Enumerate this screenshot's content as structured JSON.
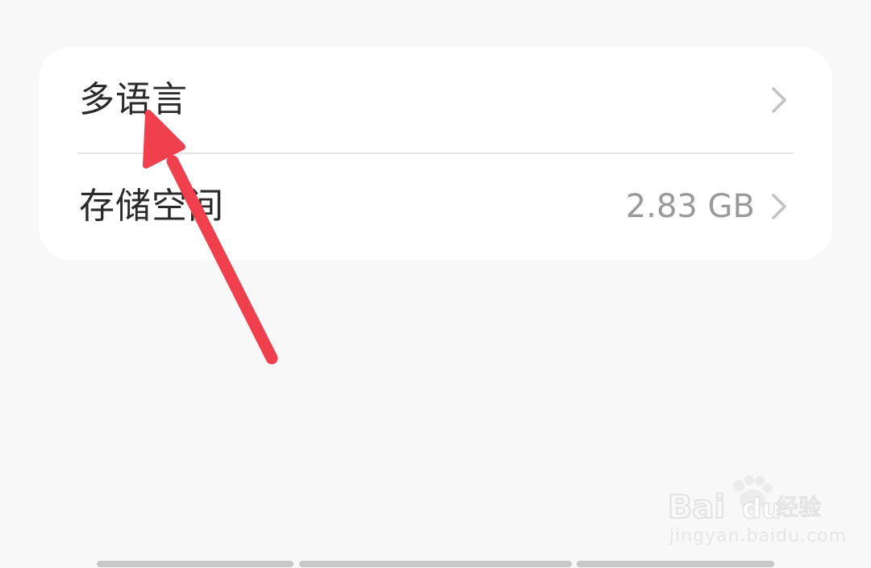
{
  "settings": {
    "items": [
      {
        "label": "多语言",
        "value": ""
      },
      {
        "label": "存储空间",
        "value": "2.83 GB"
      }
    ]
  },
  "watermark": {
    "logo_text": "Baidu经验",
    "url": "jingyan.baidu.com"
  },
  "colors": {
    "background": "#f8f8f8",
    "card": "#ffffff",
    "arrow": "#f0404e",
    "label_text": "#2b2b2b",
    "value_text": "#9a9a9a"
  },
  "icons": {
    "chevron": "chevron-right-icon",
    "annotation": "red-arrow-annotation"
  }
}
